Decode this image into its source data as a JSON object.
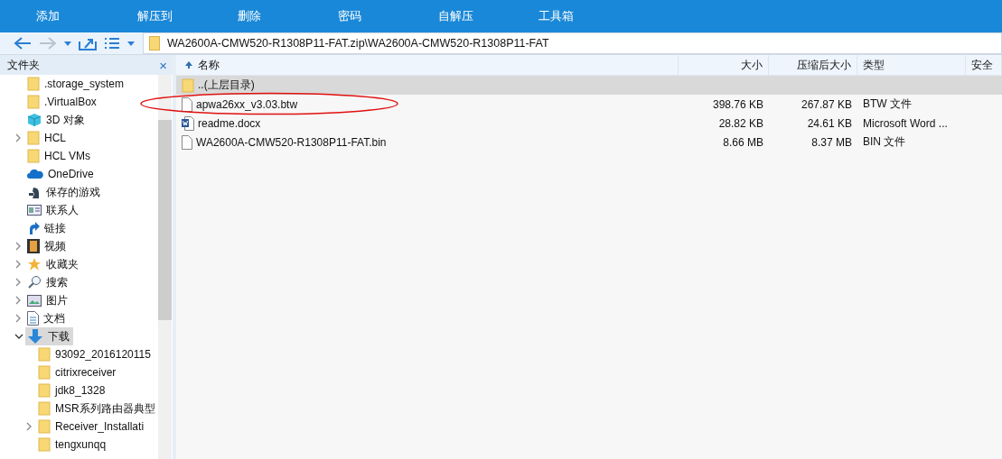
{
  "toolbar": [
    "添加",
    "解压到",
    "删除",
    "密码",
    "自解压",
    "工具箱"
  ],
  "address": {
    "path": "WA2600A-CMW520-R1308P11-FAT.zip\\WA2600A-CMW520-R1308P11-FAT"
  },
  "sidebar": {
    "title": "文件夹",
    "close": "×",
    "items": [
      {
        "label": ".storage_system",
        "kind": "folder",
        "selected": false
      },
      {
        "label": ".VirtualBox",
        "kind": "folder",
        "selected": false
      },
      {
        "label": "3D 对象",
        "kind": "cube",
        "selected": false
      },
      {
        "label": "HCL",
        "kind": "folder",
        "expanded": false,
        "selected": false
      },
      {
        "label": "HCL VMs",
        "kind": "folder",
        "selected": false
      },
      {
        "label": "OneDrive",
        "kind": "cloud",
        "selected": false
      },
      {
        "label": "保存的游戏",
        "kind": "games",
        "selected": false
      },
      {
        "label": "联系人",
        "kind": "contacts",
        "selected": false
      },
      {
        "label": "链接",
        "kind": "link",
        "selected": false
      },
      {
        "label": "视频",
        "kind": "video",
        "expanded": false,
        "selected": false
      },
      {
        "label": "收藏夹",
        "kind": "star",
        "expanded": false,
        "selected": false
      },
      {
        "label": "搜索",
        "kind": "search",
        "expanded": false,
        "selected": false
      },
      {
        "label": "图片",
        "kind": "pictures",
        "expanded": false,
        "selected": false
      },
      {
        "label": "文档",
        "kind": "document",
        "expanded": false,
        "selected": false
      },
      {
        "label": "下载",
        "kind": "download",
        "expanded": true,
        "selected": true,
        "children": [
          {
            "label": "93092_2016120115",
            "kind": "folder",
            "selected": false
          },
          {
            "label": "citrixreceiver",
            "kind": "folder",
            "selected": false
          },
          {
            "label": "jdk8_1328",
            "kind": "folder",
            "selected": false
          },
          {
            "label": "MSR系列路由器典型",
            "kind": "folder",
            "selected": false
          },
          {
            "label": "Receiver_Installati",
            "kind": "folder",
            "expanded": false,
            "selected": false
          },
          {
            "label": "tengxunqq",
            "kind": "folder",
            "selected": false
          }
        ]
      }
    ]
  },
  "table": {
    "columns": [
      "名称",
      "大小",
      "压缩后大小",
      "类型",
      "安全"
    ],
    "rows": [
      {
        "kind": "folder",
        "name": "..(上层目录)",
        "size": "",
        "packed": "",
        "type": "",
        "selected": true
      },
      {
        "kind": "file",
        "name": "apwa26xx_v3.03.btw",
        "size": "398.76 KB",
        "packed": "267.87 KB",
        "type": "BTW 文件",
        "selected": false
      },
      {
        "kind": "word",
        "name": "readme.docx",
        "size": "28.82 KB",
        "packed": "24.61 KB",
        "type": "Microsoft Word ...",
        "selected": false
      },
      {
        "kind": "file",
        "name": "WA2600A-CMW520-R1308P11-FAT.bin",
        "size": "8.66 MB",
        "packed": "8.37 MB",
        "type": "BIN 文件",
        "selected": false
      }
    ]
  }
}
